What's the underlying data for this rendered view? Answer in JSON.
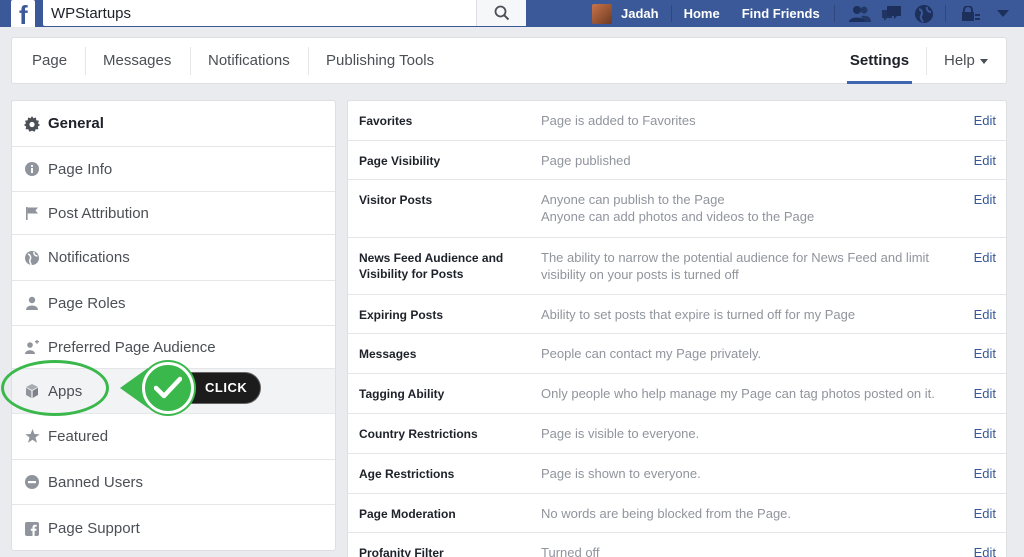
{
  "topbar": {
    "logo": "f",
    "search_value": "WPStartups",
    "user_name": "Jadah",
    "links": [
      "Home",
      "Find Friends"
    ],
    "icons": [
      "friend-requests-icon",
      "messages-icon",
      "globe-icon",
      "privacy-shortcuts-icon",
      "account-menu-icon"
    ]
  },
  "page_nav": {
    "tabs": [
      "Page",
      "Messages",
      "Notifications",
      "Publishing Tools"
    ],
    "settings": "Settings",
    "help": "Help"
  },
  "sidebar": {
    "items": [
      {
        "label": "General",
        "icon": "gear-icon"
      },
      {
        "label": "Page Info",
        "icon": "info-icon"
      },
      {
        "label": "Post Attribution",
        "icon": "flag-icon"
      },
      {
        "label": "Notifications",
        "icon": "globe-icon"
      },
      {
        "label": "Page Roles",
        "icon": "person-icon"
      },
      {
        "label": "Preferred Page Audience",
        "icon": "audience-icon"
      },
      {
        "label": "Apps",
        "icon": "cube-icon"
      },
      {
        "label": "Featured",
        "icon": "star-icon"
      },
      {
        "label": "Banned Users",
        "icon": "ban-icon"
      },
      {
        "label": "Page Support",
        "icon": "facebook-icon"
      }
    ]
  },
  "callout": {
    "text": "CLICK",
    "color": "#3bb84c"
  },
  "settings": {
    "edit_label": "Edit",
    "rows": [
      {
        "label": "Favorites",
        "value": "Page is added to Favorites"
      },
      {
        "label": "Page Visibility",
        "value": "Page published"
      },
      {
        "label": "Visitor Posts",
        "value": "Anyone can publish to the Page\nAnyone can add photos and videos to the Page"
      },
      {
        "label": "News Feed Audience and Visibility for Posts",
        "value": "The ability to narrow the potential audience for News Feed and limit visibility on your posts is turned off"
      },
      {
        "label": "Expiring Posts",
        "value": "Ability to set posts that expire is turned off for my Page"
      },
      {
        "label": "Messages",
        "value": "People can contact my Page privately."
      },
      {
        "label": "Tagging Ability",
        "value": "Only people who help manage my Page can tag photos posted on it."
      },
      {
        "label": "Country Restrictions",
        "value": "Page is visible to everyone."
      },
      {
        "label": "Age Restrictions",
        "value": "Page is shown to everyone."
      },
      {
        "label": "Page Moderation",
        "value": "No words are being blocked from the Page."
      },
      {
        "label": "Profanity Filter",
        "value": "Turned off"
      }
    ]
  },
  "colors": {
    "brand_blue": "#3b5998",
    "link_blue": "#365899",
    "active_tab": "#4267b2"
  }
}
